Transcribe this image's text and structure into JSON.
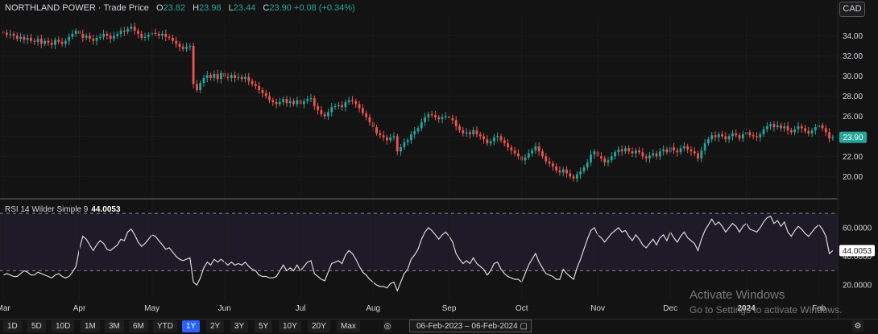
{
  "header": {
    "symbol": "NORTHLAND POWER · Trade Price",
    "open_label": "O",
    "open": "23.82",
    "high_label": "H",
    "high": "23.98",
    "low_label": "L",
    "low": "23.44",
    "close_label": "C",
    "close": "23.90",
    "change": "+0.08 (+0.34%)"
  },
  "currency_button": "CAD",
  "rsi_label": "RSI 14 Wilder Simple 9",
  "rsi_value": "44.0053",
  "price_tag": "23.90",
  "rsi_tag": "44.0053",
  "range_buttons": [
    "1D",
    "5D",
    "10D",
    "1M",
    "3M",
    "6M",
    "YTD",
    "1Y",
    "2Y",
    "3Y",
    "5Y",
    "10Y",
    "20Y",
    "Max"
  ],
  "active_range": "1Y",
  "date_range": {
    "from": "06-Feb-2023",
    "sep": "–",
    "to": "06-Feb-2024"
  },
  "watermark": {
    "title": "Activate Windows",
    "sub": "Go to Settings to activate Windows."
  },
  "colors": {
    "up": "#26a69a",
    "down": "#ef5350",
    "rsi_line": "#d8d8d8",
    "tag": "#26a69a"
  },
  "chart_data": [
    {
      "type": "candlestick",
      "title": "NORTHLAND POWER · Trade Price",
      "yaxis": {
        "ticks": [
          20,
          22,
          24,
          26,
          28,
          30,
          32,
          34
        ],
        "ylim": [
          18.5,
          35.8
        ]
      },
      "xaxis": {
        "ticks": [
          "Mar",
          "Apr",
          "May",
          "Jun",
          "Jul",
          "Aug",
          "Sep",
          "Oct",
          "Nov",
          "Dec",
          "2024",
          "Feb"
        ]
      },
      "month_index": [
        0,
        22,
        43,
        64,
        86,
        107,
        129,
        150,
        172,
        193,
        215,
        236
      ],
      "closes": [
        34.3,
        34.1,
        34.2,
        34.0,
        33.7,
        33.9,
        33.6,
        33.8,
        33.5,
        33.4,
        33.7,
        33.2,
        33.5,
        33.3,
        33.1,
        33.6,
        33.4,
        33.2,
        33.5,
        33.9,
        34.2,
        34.5,
        34.2,
        33.8,
        34.0,
        33.7,
        33.5,
        33.8,
        33.9,
        34.2,
        34.0,
        33.7,
        34.0,
        34.2,
        34.5,
        34.4,
        34.7,
        34.9,
        34.5,
        34.2,
        33.8,
        33.9,
        34.1,
        34.3,
        34.2,
        34.0,
        34.2,
        33.9,
        33.8,
        33.5,
        33.2,
        32.9,
        32.7,
        32.9,
        33.0,
        29.2,
        28.6,
        29.3,
        29.8,
        30.1,
        29.8,
        30.2,
        29.7,
        30.3,
        29.9,
        29.8,
        30.1,
        29.8,
        29.9,
        29.7,
        29.9,
        29.5,
        29.2,
        29.0,
        28.6,
        28.3,
        28.0,
        27.6,
        27.4,
        27.2,
        27.4,
        27.7,
        27.3,
        27.5,
        27.2,
        27.6,
        27.2,
        27.5,
        27.7,
        27.8,
        27.0,
        26.6,
        26.2,
        26.0,
        26.4,
        26.9,
        27.0,
        27.1,
        26.9,
        27.4,
        27.6,
        27.5,
        27.2,
        26.8,
        26.3,
        25.9,
        25.4,
        24.9,
        24.3,
        24.1,
        23.9,
        23.6,
        23.9,
        24.0,
        22.5,
        22.9,
        23.4,
        23.6,
        24.2,
        24.5,
        24.8,
        25.4,
        25.9,
        26.2,
        26.1,
        25.9,
        25.7,
        25.9,
        26.0,
        25.8,
        25.6,
        25.0,
        24.6,
        24.3,
        24.4,
        24.2,
        24.6,
        24.2,
        24.0,
        23.7,
        23.3,
        23.5,
        23.9,
        24.0,
        23.6,
        23.3,
        22.9,
        22.6,
        22.3,
        22.0,
        21.6,
        21.9,
        22.3,
        22.6,
        23.0,
        22.5,
        22.0,
        21.5,
        21.3,
        21.0,
        20.6,
        20.4,
        20.7,
        20.3,
        20.0,
        19.8,
        20.2,
        20.5,
        20.9,
        21.4,
        22.2,
        22.5,
        22.0,
        21.8,
        21.4,
        21.6,
        22.0,
        22.4,
        22.7,
        22.5,
        22.8,
        22.5,
        22.3,
        22.6,
        22.4,
        22.0,
        21.8,
        22.1,
        22.3,
        22.0,
        22.5,
        22.7,
        22.4,
        22.9,
        22.6,
        22.4,
        22.8,
        23.0,
        22.7,
        22.5,
        22.3,
        21.8,
        22.6,
        23.3,
        23.7,
        24.1,
        23.9,
        24.2,
        24.0,
        23.7,
        24.0,
        24.3,
        24.1,
        23.8,
        24.2,
        24.4,
        24.1,
        24.0,
        23.9,
        24.2,
        24.7,
        25.0,
        25.2,
        24.9,
        25.1,
        24.8,
        25.0,
        24.6,
        24.4,
        24.7,
        25.0,
        24.8,
        24.5,
        24.3,
        24.6,
        24.9,
        25.1,
        24.8,
        24.4,
        23.8,
        23.9
      ],
      "last_price": 23.9
    },
    {
      "type": "line",
      "title": "RSI 14 Wilder Simple 9",
      "yaxis": {
        "ticks": [
          20,
          40,
          60
        ],
        "ylim": [
          10,
          74
        ],
        "bands": [
          30,
          70
        ]
      },
      "values": [
        27,
        28,
        27,
        26,
        26,
        28,
        30,
        29,
        27,
        27,
        29,
        28,
        27,
        26,
        25,
        27,
        28,
        26,
        25,
        26,
        29,
        33,
        45,
        54,
        52,
        48,
        44,
        48,
        51,
        49,
        45,
        44,
        46,
        48,
        52,
        51,
        57,
        59,
        55,
        50,
        47,
        49,
        52,
        55,
        54,
        51,
        48,
        45,
        46,
        43,
        40,
        38,
        37,
        38,
        39,
        22,
        20,
        25,
        32,
        36,
        34,
        38,
        36,
        38,
        36,
        34,
        36,
        34,
        35,
        34,
        36,
        33,
        31,
        30,
        27,
        26,
        26,
        25,
        25,
        26,
        30,
        34,
        30,
        32,
        30,
        34,
        30,
        33,
        36,
        37,
        28,
        26,
        24,
        23,
        29,
        35,
        36,
        37,
        35,
        41,
        44,
        42,
        38,
        33,
        29,
        27,
        24,
        22,
        20,
        19,
        19,
        18,
        21,
        22,
        16,
        22,
        28,
        31,
        38,
        41,
        45,
        52,
        57,
        60,
        58,
        55,
        52,
        55,
        57,
        54,
        50,
        42,
        38,
        35,
        37,
        35,
        39,
        35,
        33,
        31,
        27,
        30,
        35,
        36,
        31,
        28,
        26,
        25,
        24,
        24,
        22,
        28,
        34,
        38,
        42,
        36,
        32,
        28,
        27,
        26,
        24,
        24,
        31,
        28,
        26,
        24,
        32,
        38,
        45,
        52,
        58,
        60,
        55,
        53,
        50,
        53,
        56,
        58,
        60,
        57,
        58,
        54,
        51,
        55,
        52,
        48,
        46,
        49,
        52,
        48,
        53,
        55,
        51,
        57,
        53,
        50,
        54,
        57,
        53,
        51,
        49,
        44,
        52,
        58,
        62,
        66,
        62,
        64,
        61,
        57,
        60,
        63,
        61,
        57,
        61,
        63,
        59,
        58,
        57,
        60,
        64,
        67,
        68,
        63,
        65,
        61,
        64,
        57,
        54,
        58,
        61,
        59,
        56,
        54,
        57,
        60,
        62,
        59,
        54,
        42,
        44
      ],
      "last_value": 44.0053
    }
  ]
}
